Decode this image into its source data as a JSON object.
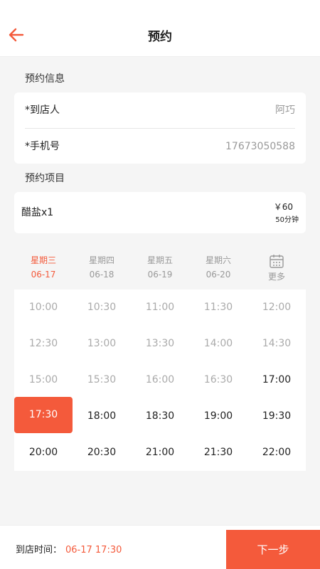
{
  "header": {
    "title": "预约",
    "back_icon": "arrow-left-icon"
  },
  "colors": {
    "accent": "#f45a3b",
    "muted": "#999999",
    "disabled_slot": "#aaaaaa"
  },
  "info": {
    "section_title": "预约信息",
    "name_label": "*到店人",
    "name_value": "阿巧",
    "phone_label": "*手机号",
    "phone_value": "17673050588"
  },
  "project": {
    "section_title": "预约项目",
    "service_name": "醋盐x1",
    "price": "￥60",
    "duration": "50分钟"
  },
  "days": [
    {
      "week": "星期三",
      "date": "06-17",
      "active": true
    },
    {
      "week": "星期四",
      "date": "06-18",
      "active": false
    },
    {
      "week": "星期五",
      "date": "06-19",
      "active": false
    },
    {
      "week": "星期六",
      "date": "06-20",
      "active": false
    }
  ],
  "more": {
    "label": "更多",
    "icon": "calendar-icon"
  },
  "slots": [
    [
      "10:00",
      "10:30",
      "11:00",
      "11:30",
      "12:00"
    ],
    [
      "12:30",
      "13:00",
      "13:30",
      "14:00",
      "14:30"
    ],
    [
      "15:00",
      "15:30",
      "16:00",
      "16:30",
      "17:00"
    ],
    [
      "17:30",
      "18:00",
      "18:30",
      "19:00",
      "19:30"
    ],
    [
      "20:00",
      "20:30",
      "21:00",
      "21:30",
      "22:00"
    ]
  ],
  "available_from": "17:00",
  "selected_slot": "17:30",
  "footer": {
    "label": "到店时间：",
    "time": "06-17 17:30",
    "next_label": "下一步"
  }
}
